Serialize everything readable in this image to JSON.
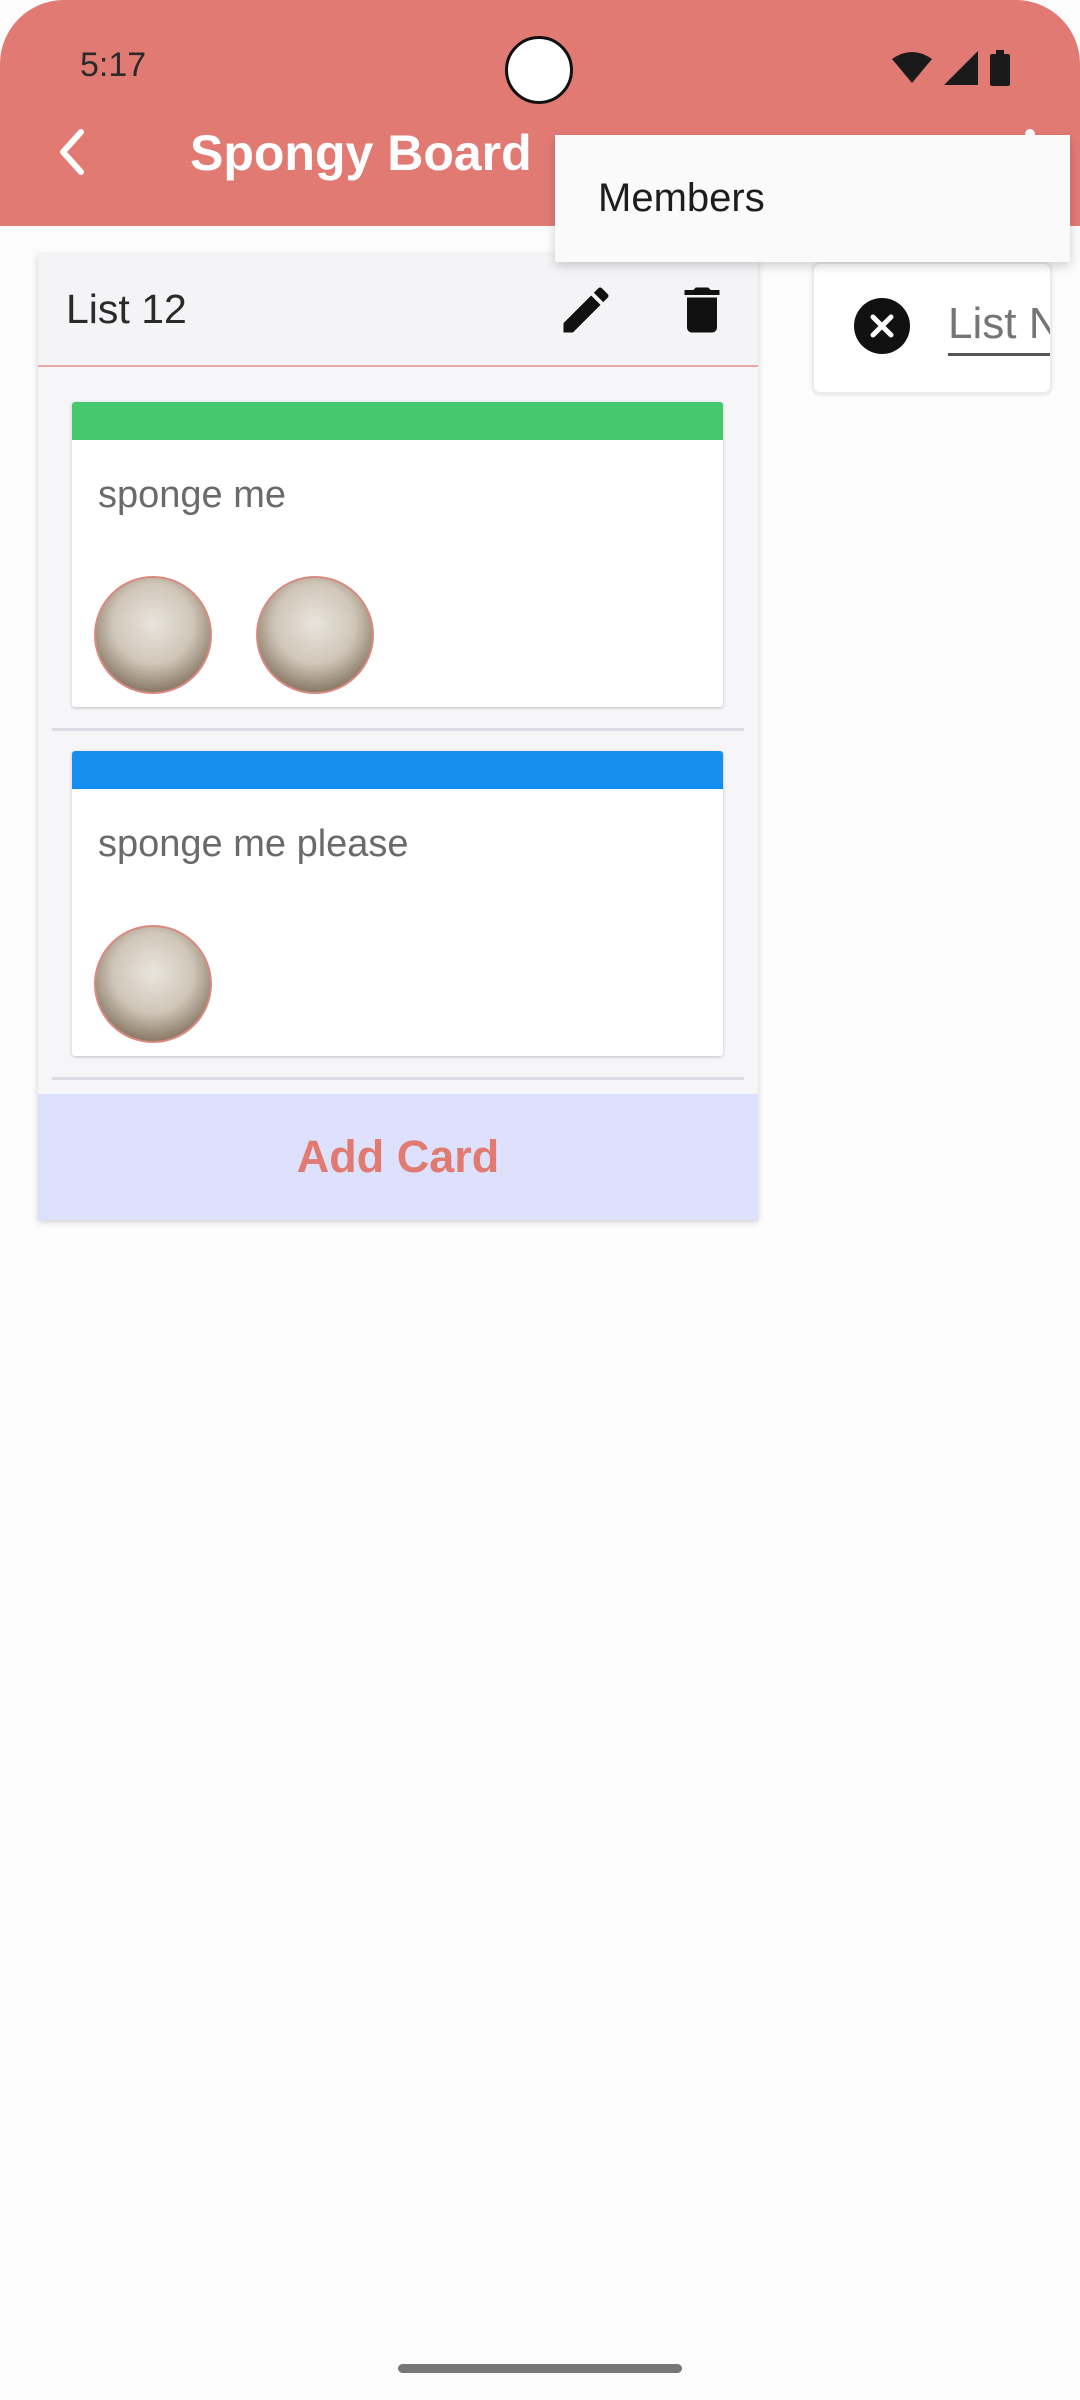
{
  "status_bar": {
    "time": "5:17",
    "icons": [
      "wifi-icon",
      "signal-icon",
      "battery-icon"
    ]
  },
  "app_bar": {
    "title": "Spongy Board",
    "back_icon": "chevron-left-icon",
    "overflow_icon": "more-vert-icon",
    "color": "#e27a74"
  },
  "menu": {
    "items": [
      {
        "label": "Members"
      }
    ]
  },
  "list": {
    "title": "List 12",
    "edit_icon": "pencil-icon",
    "delete_icon": "trash-icon",
    "cards": [
      {
        "text": "sponge me",
        "label_color": "#45c86e",
        "member_avatars": 2
      },
      {
        "text": "sponge me please",
        "label_color": "#148ff0",
        "member_avatars": 1
      }
    ],
    "add_card_label": "Add Card",
    "add_card_color": "#e17b72"
  },
  "new_list": {
    "placeholder": "List Name",
    "close_icon": "close-circle-icon"
  }
}
